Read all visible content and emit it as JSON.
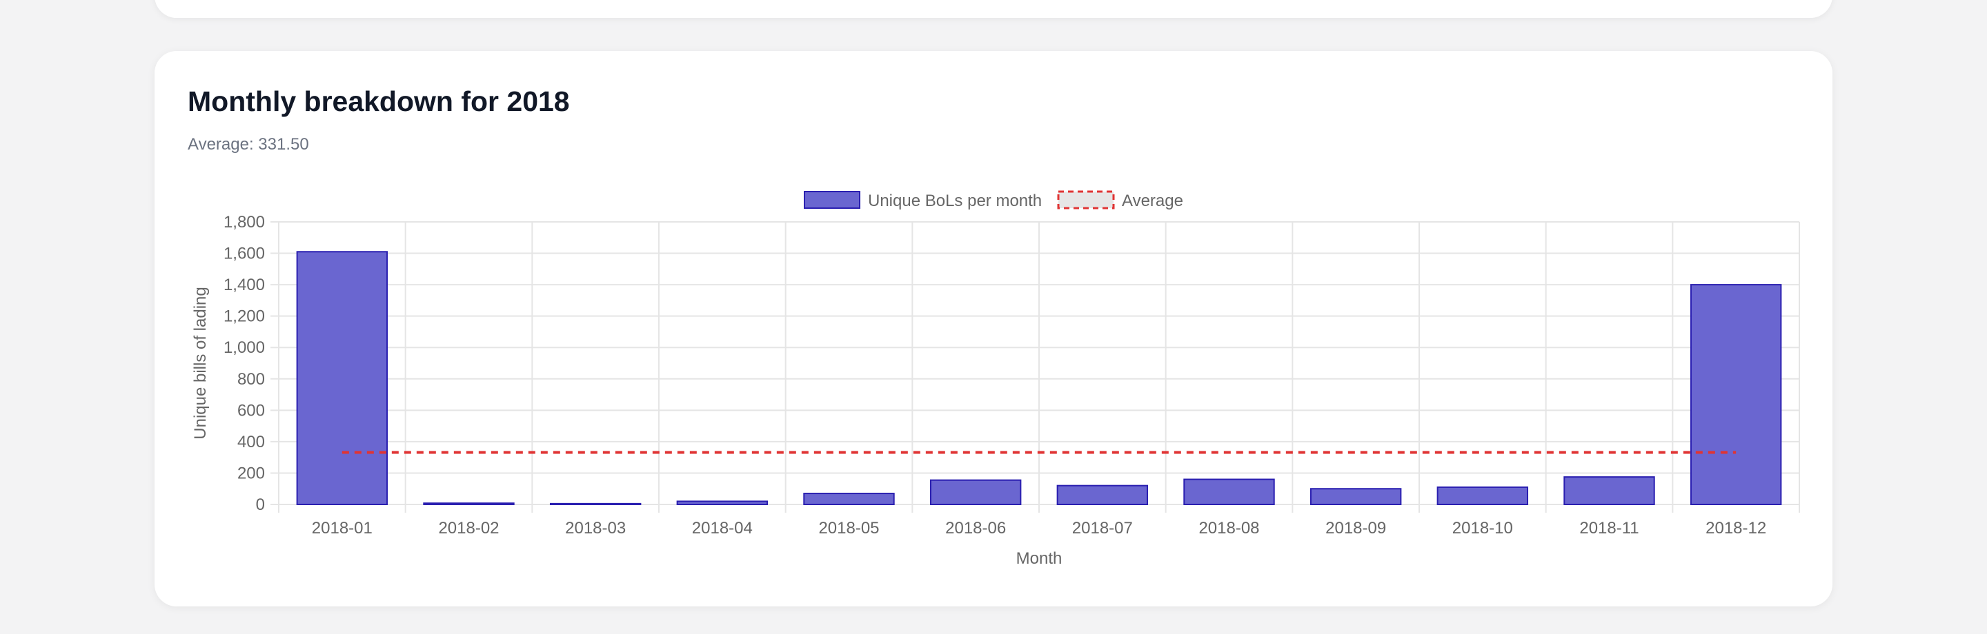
{
  "card": {
    "title": "Monthly breakdown for 2018",
    "subtitle": "Average: 331.50"
  },
  "colors": {
    "bar_fill": "#6a66d0",
    "bar_stroke": "#2a1fb0",
    "average_line": "#e03434",
    "average_legend_fill": "#e6e6e6",
    "grid": "#e5e5e5",
    "tick_text": "#666666"
  },
  "chart_data": {
    "type": "bar",
    "categories": [
      "2018-01",
      "2018-02",
      "2018-03",
      "2018-04",
      "2018-05",
      "2018-06",
      "2018-07",
      "2018-08",
      "2018-09",
      "2018-10",
      "2018-11",
      "2018-12"
    ],
    "series": [
      {
        "name": "Unique BoLs per month",
        "type": "bar",
        "values": [
          1610,
          8,
          5,
          20,
          70,
          155,
          120,
          160,
          100,
          110,
          175,
          1400
        ]
      },
      {
        "name": "Average",
        "type": "line",
        "style": "dashed",
        "values": [
          331.5,
          331.5,
          331.5,
          331.5,
          331.5,
          331.5,
          331.5,
          331.5,
          331.5,
          331.5,
          331.5,
          331.5
        ]
      }
    ],
    "xlabel": "Month",
    "ylabel": "Unique bills of lading",
    "ylim": [
      0,
      1800
    ],
    "yticks": [
      0,
      200,
      400,
      600,
      800,
      1000,
      1200,
      1400,
      1600,
      1800
    ],
    "ytick_labels": [
      "0",
      "200",
      "400",
      "600",
      "800",
      "1,000",
      "1,200",
      "1,400",
      "1,600",
      "1,800"
    ],
    "grid": true,
    "legend_position": "top-center"
  }
}
